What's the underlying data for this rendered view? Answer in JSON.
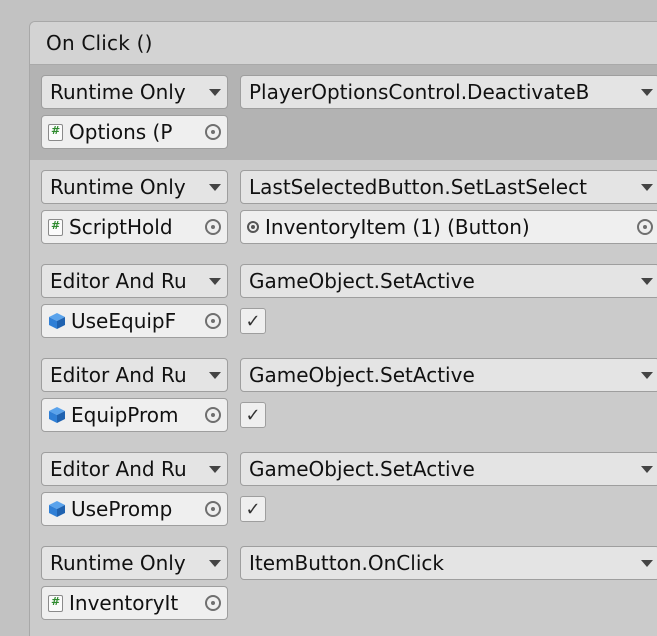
{
  "event": {
    "title": "On Click ()"
  },
  "entries": [
    {
      "mode": "Runtime Only",
      "function": "PlayerOptionsControl.DeactivateB",
      "object": "Options (P",
      "object_icon": "script-icon",
      "selected": true
    },
    {
      "mode": "Runtime Only",
      "function": "LastSelectedButton.SetLastSelect",
      "object": "ScriptHold",
      "object_icon": "script-icon",
      "argument": "InventoryItem (1) (Button)"
    },
    {
      "mode": "Editor And Ru",
      "function": "GameObject.SetActive",
      "object": "UseEquipF",
      "object_icon": "cube-icon",
      "checked": true
    },
    {
      "mode": "Editor And Ru",
      "function": "GameObject.SetActive",
      "object": "EquipProm",
      "object_icon": "cube-icon",
      "checked": true
    },
    {
      "mode": "Editor And Ru",
      "function": "GameObject.SetActive",
      "object": "UsePromp",
      "object_icon": "cube-icon",
      "checked": true
    },
    {
      "mode": "Runtime Only",
      "function": "ItemButton.OnClick",
      "object": "InventoryIt",
      "object_icon": "script-icon"
    }
  ],
  "colors": {
    "cube": "#2f7fd6",
    "script_green": "#2d8a2d"
  },
  "checkmark": "✓"
}
